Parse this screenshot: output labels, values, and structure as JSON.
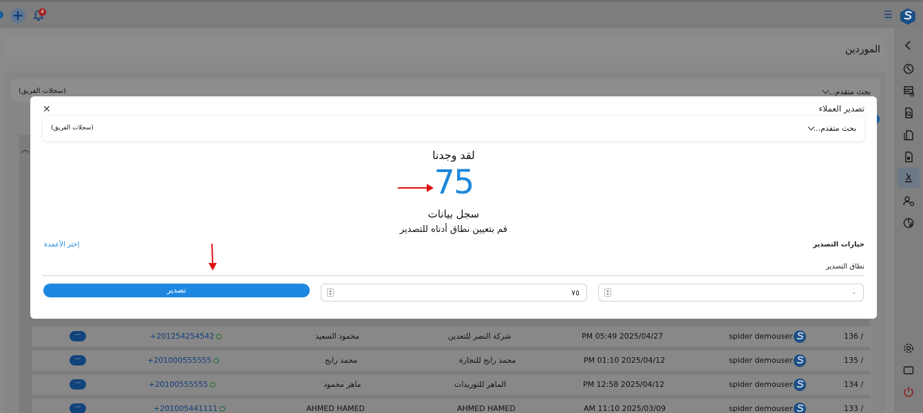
{
  "page": {
    "title": "الموردين"
  },
  "topbar": {
    "notification_count": "4"
  },
  "background": {
    "filter_left": "(سجلات الفريق)",
    "filter_right": "بحث متقدم..."
  },
  "rows": [
    {
      "id": "136 /",
      "user": "spider demouser",
      "date": "PM 05:49 2025/04/27",
      "company": "شركة النصر للتعدين",
      "name": "محمود السعيد",
      "phone": "+201254254542"
    },
    {
      "id": "135 /",
      "user": "spider demouser",
      "date": "PM 01:10 2025/04/12",
      "company": "محمد رابح للتجارة",
      "name": "محمد رابح",
      "phone": "+201000555555"
    },
    {
      "id": "134 /",
      "user": "spider demouser",
      "date": "PM 12:58 2025/04/12",
      "company": "الماهر للتوريدات",
      "name": "ماهر محمود",
      "phone": "+20100555555"
    },
    {
      "id": "133 /",
      "user": "spider demouser",
      "date": "AM 11:10 2025/03/09",
      "company": "AHMED HAMED",
      "name": "AHMED HAMED",
      "phone": "+201005441111"
    }
  ],
  "row_more_label": "···",
  "modal": {
    "title": "تصدير العملاء",
    "filter_left": "(سجلات الفريق)",
    "filter_right": "بحث متقدم...",
    "found_label": "لقد وجدنا",
    "count": "75",
    "records_label": "سجل بيانات",
    "set_range_label": "قم بتعيين نطاق أدناه للتصدير",
    "export_options_label": "خيارات التصدير",
    "choose_columns_label": "إختر الأعمدة",
    "range_label": "نطاق التصدير",
    "range_from": "٠",
    "range_to": "٧٥",
    "export_button": "تصدير"
  },
  "colors": {
    "accent": "#1e88e0",
    "count_color": "#1e88d9",
    "arrow": "#e01010"
  }
}
